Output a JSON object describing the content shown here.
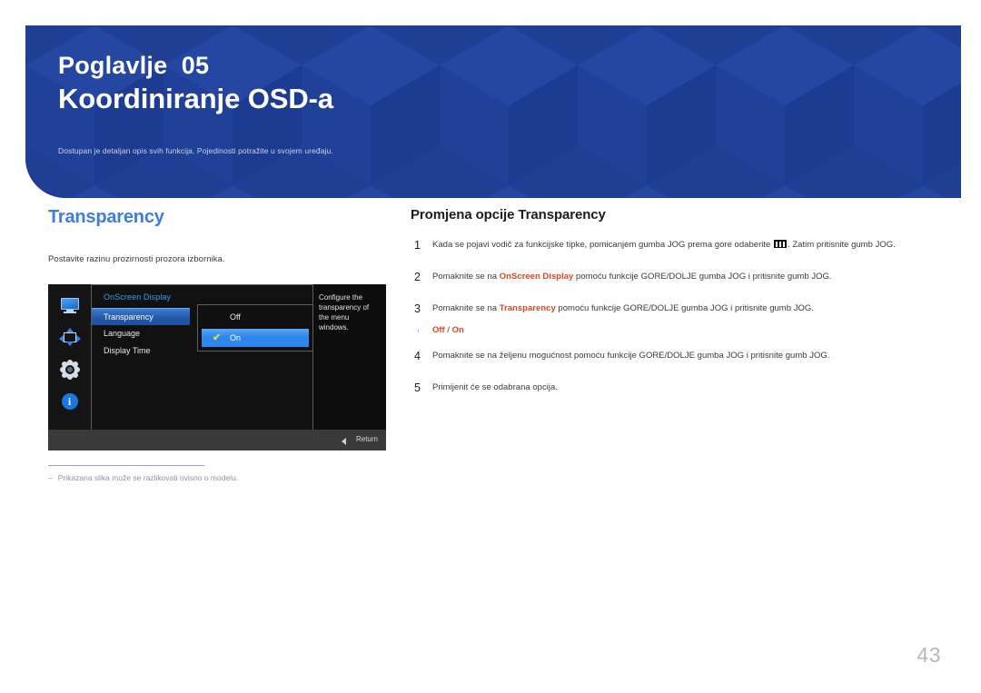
{
  "banner": {
    "chapter_label": "Poglavlje  05",
    "chapter_title": "Koordiniranje OSD-a",
    "subtitle": "Dostupan je detaljan opis svih funkcija. Pojedinosti potražite u svojem uređaju.",
    "bg_color": "#1f3e94"
  },
  "left": {
    "section_title": "Transparency",
    "section_title_color": "#3d7ce0",
    "description": "Postavite razinu prozirnosti prozora izbornika.",
    "osd": {
      "menu_title": "OnScreen Display",
      "items": [
        {
          "label": "Transparency",
          "selected": true
        },
        {
          "label": "Language",
          "selected": false
        },
        {
          "label": "Display Time",
          "selected": false
        }
      ],
      "options": [
        {
          "label": "Off",
          "checked": false
        },
        {
          "label": "On",
          "checked": true
        }
      ],
      "check_glyph": "✔",
      "description": "Configure the transparency of the menu windows.",
      "return_label": "Return",
      "rail_icons": [
        "monitor-icon",
        "resize-arrows-icon",
        "gear-icon",
        "info-icon"
      ],
      "info_glyph": "i"
    },
    "footnote_marker": "‒",
    "footnote": "Prikazana slika može se razlikovati ovisno o modelu."
  },
  "right": {
    "title": "Promjena opcije Transparency",
    "steps": [
      {
        "num": "1",
        "before": "Kada se pojavi vodič za funkcijske tipke, pomicanjem gumba JOG prema gore odaberite ",
        "icon": "menu-icon",
        "after": ". Zatim pritisnite gumb JOG."
      },
      {
        "num": "2",
        "before": "Pomaknite se na ",
        "highlight": "OnScreen Display",
        "after": " pomoću funkcije GORE/DOLJE gumba JOG i pritisnite gumb JOG."
      },
      {
        "num": "3",
        "before": "Pomaknite se na ",
        "highlight": "Transparency",
        "after": " pomoću funkcije GORE/DOLJE gumba JOG i pritisnite gumb JOG."
      },
      {
        "num": "4",
        "before": "Pomaknite se na željenu mogućnost pomoću funkcije GORE/DOLJE gumba JOG i pritisnite gumb JOG.",
        "after": ""
      },
      {
        "num": "5",
        "before": "Primijenit će se odabrana opcija.",
        "after": ""
      }
    ],
    "bullet": {
      "dot": "·",
      "option_off": "Off",
      "separator": " / ",
      "option_on": "On",
      "color": "#e8431f"
    }
  },
  "page_number": "43"
}
